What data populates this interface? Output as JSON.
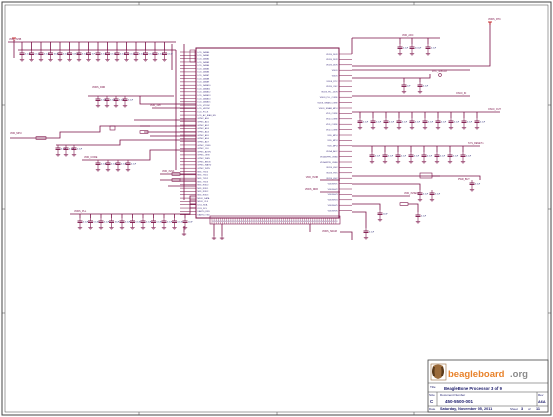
{
  "colors": {
    "wire": "#7a1046",
    "frame": "#444444",
    "text": "#1a1a6a",
    "pin_text": "#3a2a7a",
    "net_label": "#7a1046",
    "ground": "#7a1046",
    "power": "#c00000",
    "logo_orange": "#e8822a",
    "logo_gray": "#8a8a8a",
    "logo_head": "#9a6a3a"
  },
  "title_block": {
    "logo_text_main": "beagleboard",
    "logo_text_suffix": ".org",
    "title_caption": "Title",
    "title": "BeagleBone Processor 3 of 9",
    "size_caption": "Size",
    "doc_caption": "Document Number",
    "rev_caption": "Rev",
    "size": "C",
    "doc_number": "450-5500-001",
    "rev": "A6A",
    "date_caption": "Date",
    "date": "Saturday, November 05, 2011",
    "sheet_caption": "Sheet",
    "sheet_text": "3",
    "of_caption": "of",
    "sheet_total": "11"
  },
  "schematic": {
    "left_block_pins": [
      "LCD_DATA0",
      "LCD_DATA1",
      "LCD_DATA2",
      "LCD_DATA3",
      "LCD_DATA4",
      "LCD_DATA5",
      "LCD_DATA6",
      "LCD_DATA7",
      "LCD_DATA8",
      "LCD_DATA9",
      "LCD_DATA10",
      "LCD_DATA11",
      "LCD_DATA12",
      "LCD_DATA13",
      "LCD_DATA14",
      "LCD_DATA15",
      "LCD_VSYNC",
      "LCD_HSYNC",
      "LCD_PCLK",
      "LCD_AC_BIAS_EN",
      "GPMC_AD0",
      "GPMC_AD1",
      "GPMC_AD2",
      "GPMC_AD3",
      "GPMC_AD4",
      "GPMC_AD5",
      "GPMC_AD6",
      "GPMC_AD7",
      "GPMC_CSN0",
      "GPMC_CLK",
      "GPMC_ADVN",
      "GPMC_OEN",
      "GPMC_WEN",
      "GPMC_BE0N",
      "GPMC_WAIT0",
      "GPMC_WPN",
      "MII1_TXD0",
      "MII1_TXD1",
      "MII1_TXD2",
      "MII1_TXD3",
      "MII1_RXD0",
      "MII1_RXD1",
      "MII1_RXD2",
      "MII1_RXD3",
      "MDIO_DATA",
      "MDIO_CLK",
      "I2C0_SDA",
      "I2C0_SCL",
      "UART0_RXD",
      "UART0_TXD"
    ],
    "right_block_pins": [
      "VDDS_DDR",
      "VDDS_DDR",
      "VDDS_DDR",
      "VDDS",
      "VDDS",
      "VDDS_RTC",
      "VDDS_OSC",
      "VDDS_PLL_DDR",
      "VDDS_PLL_CORE",
      "VDDS_SRAM_CORE",
      "VDDS_SRAM_MPU",
      "VDD_CORE",
      "VDD_CORE",
      "VDD_CORE",
      "VDD_CORE",
      "VDD_MPU",
      "VDD_MPU",
      "VDD_MPU",
      "VDDA_ADC",
      "VDDA1P8V_USB0",
      "VDDA3P3V_USB0",
      "VDDS_HVX",
      "VDDS_HVX",
      "VDDS_HVX",
      "VDDSHV1",
      "VDDSHV2",
      "VDDSHV3",
      "VDDSHV4",
      "VDDSHV5",
      "VDDSHV6"
    ],
    "bottom_block_pins": [
      "VSS",
      "VSS",
      "VSS",
      "VSS",
      "VSS",
      "VSS",
      "VSS",
      "VSS",
      "VSS",
      "VSS",
      "VSS",
      "VSS",
      "VSS",
      "VSS",
      "VSS",
      "VSS",
      "VSS",
      "VSS",
      "VSS",
      "VSS",
      "VSS",
      "VSS",
      "VSS",
      "VSS",
      "VSS",
      "VSS",
      "VSS",
      "VSS",
      "VSS",
      "VSS",
      "VSS",
      "VSS",
      "VSS",
      "VSS",
      "VSS",
      "VSS",
      "VSS",
      "VSS",
      "VSS",
      "VSS",
      "VSS",
      "VSS",
      "VSS",
      "VSS",
      "VSS",
      "VSS",
      "VSS",
      "VSS",
      "VSS",
      "VSS",
      "VSS",
      "VSS",
      "VSS",
      "VSS",
      "VSS",
      "VSS",
      "VSS",
      "VSS",
      "VSS",
      "VSS"
    ],
    "cap_values": [
      "0.1uF",
      "0.1uF",
      "0.1uF",
      "10uF",
      "0.1uF",
      "0.01uF",
      "0.1uF",
      "1uF",
      "0.1uF",
      "0.1uF",
      "0.1uF",
      "0.1uF",
      "0.1uF",
      "0.1uF",
      "0.1uF",
      "0.1uF",
      "0.1uF",
      "0.1uF",
      "0.1uF",
      "0.1uF",
      "0.1uF",
      "0.1uF",
      "0.1uF",
      "0.1uF",
      "0.1uF",
      "0.1uF",
      "0.1uF",
      "0.1uF",
      "0.1uF",
      "0.1uF",
      "10uF",
      "0.1uF",
      "0.1uF",
      "0.1uF"
    ],
    "net_labels": [
      "VDD_3V3B",
      "VDDS_DDR",
      "VDD_1V8",
      "VDD_MPU",
      "VDD_CORE",
      "VDD_3V3A",
      "VDDS_PLL",
      "VDDS_RTC",
      "VDD_ADC",
      "RTC_32KCLK",
      "OSC0_IN",
      "OSC0_OUT",
      "SYS_RESETn",
      "PWR_BUT",
      "VDD_3V3EXP",
      "VDDS_SRAM"
    ]
  }
}
